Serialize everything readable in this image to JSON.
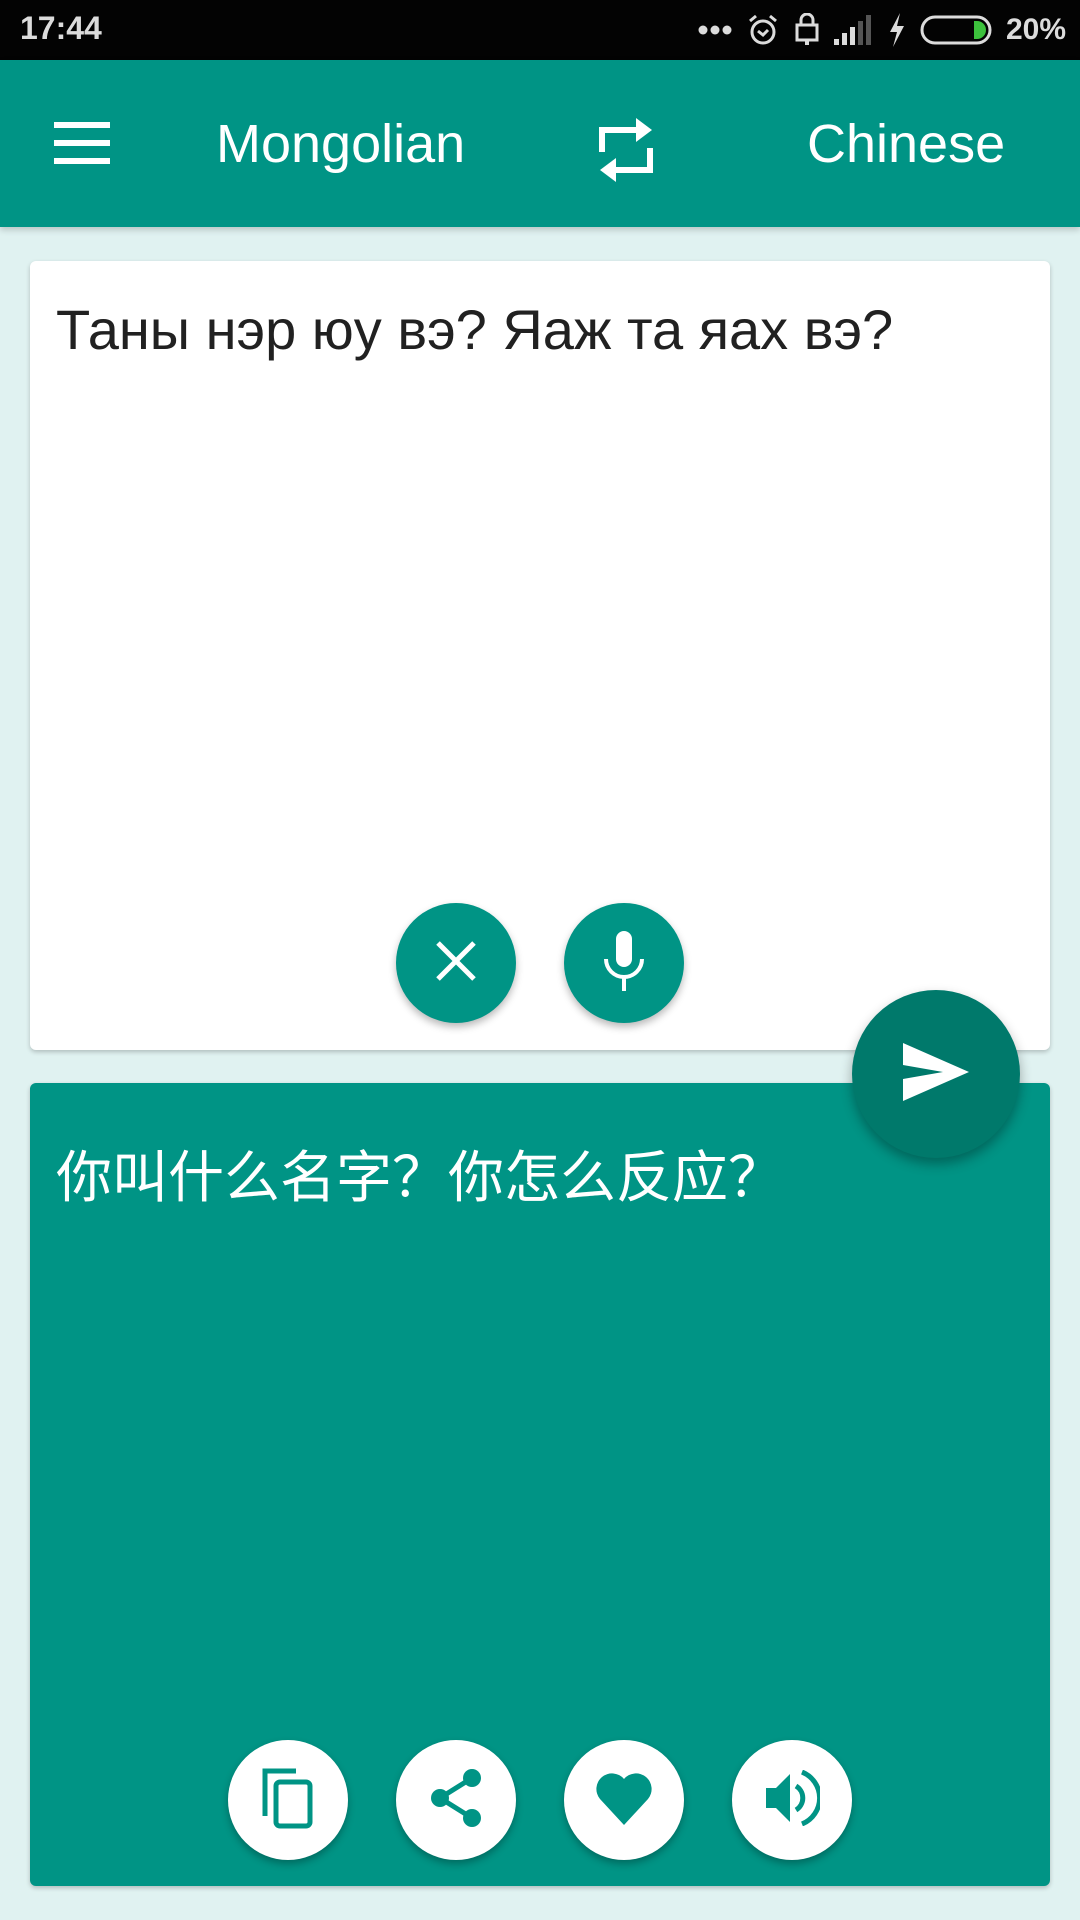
{
  "status_bar": {
    "time": "17:44",
    "battery_percent": "20%",
    "battery_level": 0.2,
    "icons": [
      "more-dots-icon",
      "alarm-icon",
      "lock-icon",
      "signal-icon",
      "charging-icon",
      "battery-icon"
    ]
  },
  "app_bar": {
    "menu_icon": "hamburger-menu-icon",
    "source_language": "Mongolian",
    "swap_icon": "swap-languages-icon",
    "target_language": "Chinese"
  },
  "source_card": {
    "input_text": "Таны нэр юу вэ? Яаж та яах вэ?",
    "buttons": [
      {
        "name": "clear",
        "icon": "close-icon"
      },
      {
        "name": "voice-input",
        "icon": "microphone-icon"
      }
    ]
  },
  "send_button": {
    "icon": "send-icon"
  },
  "result_card": {
    "translated_text": "你叫什么名字？你怎么反应？",
    "buttons": [
      {
        "name": "copy",
        "icon": "copy-icon"
      },
      {
        "name": "share",
        "icon": "share-icon"
      },
      {
        "name": "favorite",
        "icon": "heart-icon"
      },
      {
        "name": "speak",
        "icon": "speaker-icon"
      }
    ]
  },
  "colors": {
    "primary": "#009485",
    "primary_dark": "#00796b",
    "background": "#e0f2f1",
    "status_bar": "#030303",
    "battery_fill": "#3cc13c"
  }
}
